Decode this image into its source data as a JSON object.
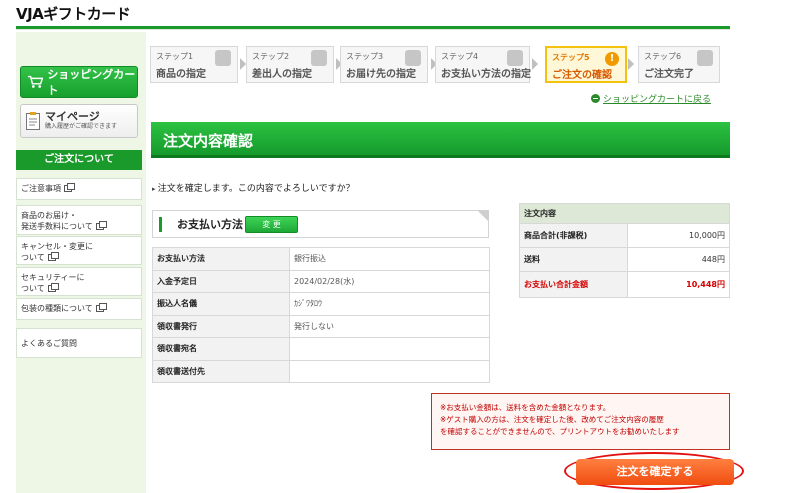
{
  "header": {
    "logo_text": "VJAギフトカード",
    "brand_color": "#1a9a2a"
  },
  "sidebar": {
    "cart_label": "ショッピングカート",
    "mypage_title": "マイページ",
    "mypage_sub": "購入履歴がご確認できます",
    "section_title": "ご注文について",
    "links": [
      {
        "line1": "ご注意事項",
        "line2": ""
      },
      {
        "line1": "商品のお届け・",
        "line2": "発送手数料について"
      },
      {
        "line1": "キャンセル・変更に",
        "line2": "ついて"
      },
      {
        "line1": "セキュリティーに",
        "line2": "ついて"
      },
      {
        "line1": "包装の種類について",
        "line2": ""
      },
      {
        "line1": "よくあるご質問",
        "line2": ""
      }
    ]
  },
  "steps": [
    {
      "num": "ステップ1",
      "label": "商品の指定"
    },
    {
      "num": "ステップ2",
      "label": "差出人の指定"
    },
    {
      "num": "ステップ3",
      "label": "お届け先の指定"
    },
    {
      "num": "ステップ4",
      "label": "お支払い方法の指定"
    },
    {
      "num": "ステップ5",
      "label": "ご注文の確認",
      "active": true
    },
    {
      "num": "ステップ6",
      "label": "ご注文完了"
    }
  ],
  "back_to_cart": "ショッピングカートに戻る",
  "page_title": "注文内容確認",
  "confirm_question": "注文を確定します。この内容でよろしいですか？",
  "payment": {
    "section_title": "お支払い方法",
    "change_label": "変 更",
    "rows": [
      {
        "key": "お支払い方法",
        "value": "銀行振込"
      },
      {
        "key": "入金予定日",
        "value": "2024/02/28(水)"
      },
      {
        "key": "振込人名儀",
        "value": "ｶｼﾞﾜﾀﾛｳ"
      },
      {
        "key": "領収書発行",
        "value": "発行しない"
      },
      {
        "key": "領収書宛名",
        "value": ""
      },
      {
        "key": "領収書送付先",
        "value": ""
      }
    ]
  },
  "summary": {
    "header": "注文内容",
    "rows": [
      {
        "key": "商品合計(非課税)",
        "value": "10,000円"
      },
      {
        "key": "送料",
        "value": "448円"
      }
    ],
    "total_key": "お支払い合計金額",
    "total_value": "10,448円"
  },
  "notice": {
    "line1": "※お支払い金額は、送料を含めた金額となります。",
    "line2": "※ゲスト購入の方は、注文を確定した後、改めてご注文内容の履歴",
    "line3": "を確認することができませんので、プリントアウトをお勧めいたします"
  },
  "confirm_button": "注文を確定する"
}
